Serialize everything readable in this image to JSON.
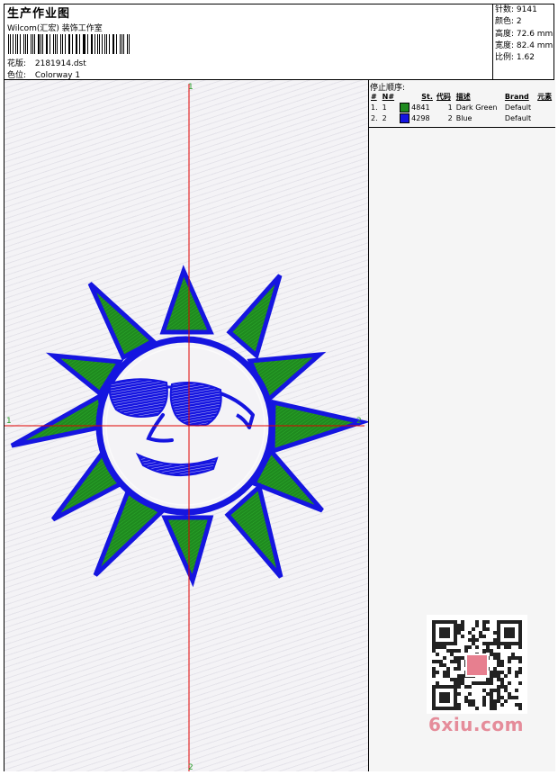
{
  "header": {
    "title": "生产作业图",
    "studio": "Wilcom(汇宏) 装饰工作室",
    "pattern_label": "花版:",
    "pattern_value": "2181914.dst",
    "colorway_label": "色位:",
    "colorway_value": "Colorway 1"
  },
  "stats": {
    "stitches": "针数: 9141",
    "colors": "颜色: 2",
    "height": "高度: 72.6 mm",
    "width": "宽度: 82.4 mm",
    "ratio": "比例: 1.62"
  },
  "stop_sequence": {
    "title": "停止顺序:",
    "headers": [
      "#",
      "N#",
      "St.",
      "代码",
      "描述",
      "Brand",
      "元素"
    ],
    "rows": [
      {
        "num": "1.",
        "n": "1",
        "color": "#1f8a1f",
        "stitches": "4841",
        "code": "1",
        "desc": "Dark Green",
        "brand": "Default"
      },
      {
        "num": "2.",
        "n": "2",
        "color": "#1515e0",
        "stitches": "4298",
        "code": "2",
        "desc": "Blue",
        "brand": "Default"
      }
    ]
  },
  "axes": {
    "top": "1",
    "bottom": "2",
    "left": "1",
    "right": "2"
  },
  "watermark": "6xiu.com",
  "colors": {
    "green": "#1f8a1f",
    "blue": "#1515e0",
    "axis_red": "#e00000"
  }
}
